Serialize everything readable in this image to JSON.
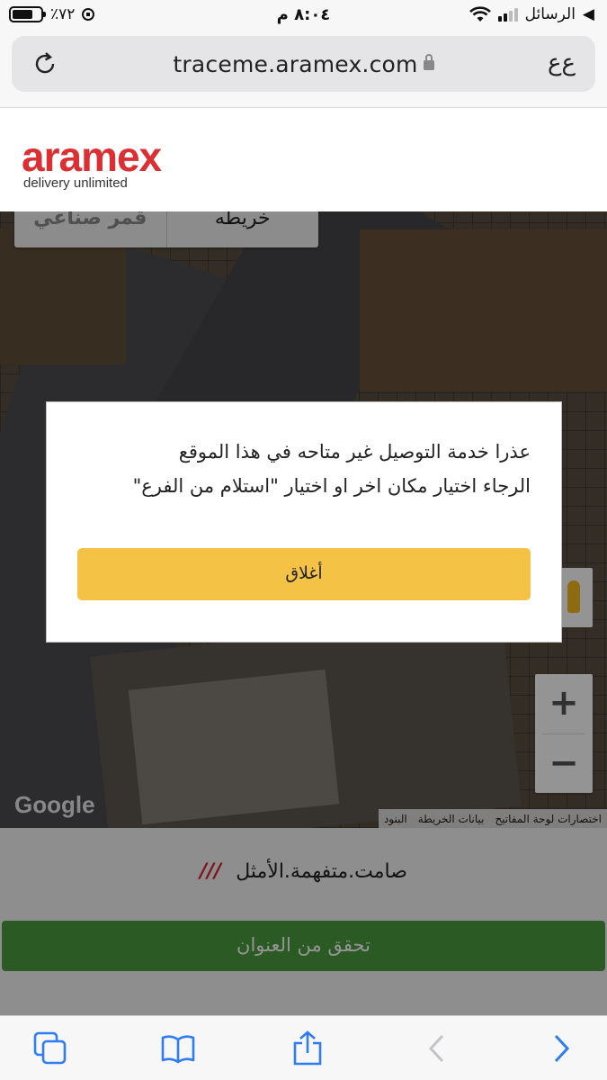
{
  "status_bar": {
    "carrier": "الرسائل",
    "time": "٨:٠٤ م",
    "battery": "٪٧٢",
    "battery_level": 0.72
  },
  "browser": {
    "url": "traceme.aramex.com",
    "reader_label": "ﻉﻉ"
  },
  "header": {
    "logo_text": "aramex",
    "logo_tagline": "delivery unlimited"
  },
  "map": {
    "type_control": [
      "خريطه",
      "قمر صناعي"
    ],
    "selected_type": "قمر صناعي",
    "zoom_in": "+",
    "zoom_out": "−",
    "google_label": "Google",
    "attribution": [
      "اختصارات لوحة المفاتيح",
      "بيانات الخريطة",
      "البنود"
    ]
  },
  "address": {
    "text": "صامت.متفهمة.الأمثل",
    "slashes": "///"
  },
  "verify_button": "تحقق من العنوان",
  "dialog": {
    "line1": "عذرا خدمة التوصيل غير متاحه في هذا الموقع",
    "line2": "الرجاء اختيار مكان اخر او اختيار \"استلام من الفرع\"",
    "close_label": "أغلاق"
  },
  "colors": {
    "brand_red": "#dc2f34",
    "close_button": "#f4c245",
    "verify_button": "#4a9b3e"
  }
}
